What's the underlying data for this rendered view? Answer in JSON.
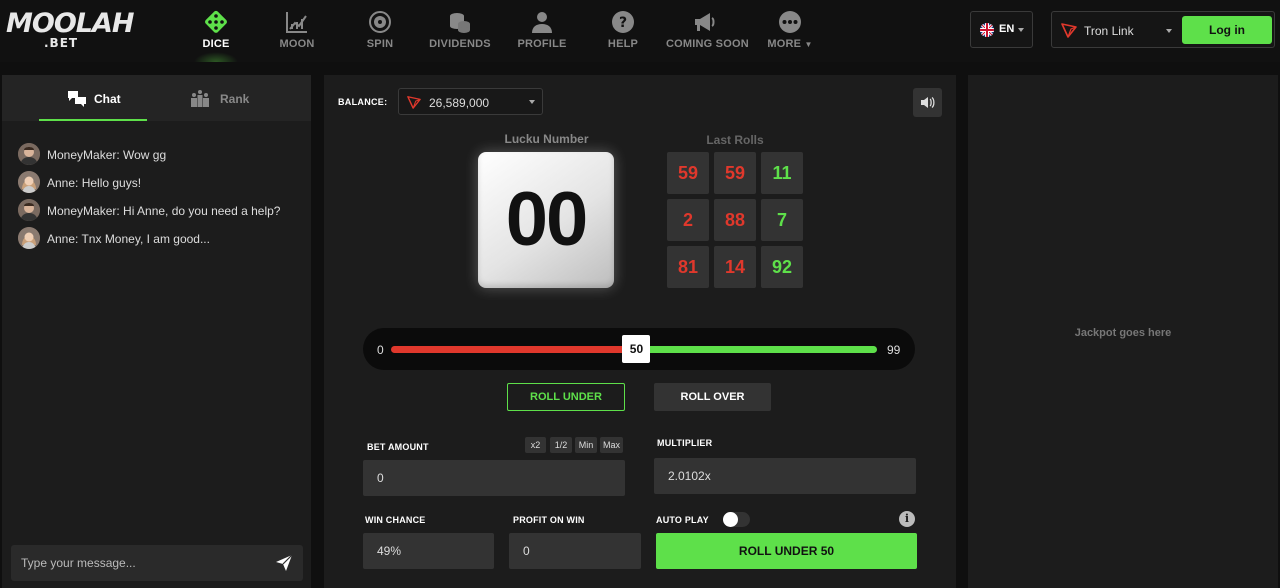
{
  "header": {
    "logo_main": "MOOLAH",
    "logo_sub": ".BET",
    "nav": [
      {
        "label": "DICE",
        "icon": "dice-icon",
        "active": true
      },
      {
        "label": "MOON",
        "icon": "chart-icon",
        "active": false
      },
      {
        "label": "SPIN",
        "icon": "wheel-icon",
        "active": false
      },
      {
        "label": "DIVIDENDS",
        "icon": "coins-icon",
        "active": false
      },
      {
        "label": "PROFILE",
        "icon": "user-icon",
        "active": false
      },
      {
        "label": "HELP",
        "icon": "help-icon",
        "active": false
      },
      {
        "label": "COMING SOON",
        "icon": "megaphone-icon",
        "active": false
      },
      {
        "label": "MORE",
        "icon": "more-icon",
        "active": false
      }
    ],
    "language": "EN",
    "wallet": "Tron Link",
    "login_label": "Log in"
  },
  "chat": {
    "tabs": [
      {
        "label": "Chat",
        "active": true
      },
      {
        "label": "Rank",
        "active": false
      }
    ],
    "messages": [
      {
        "text": "MoneyMaker: Wow gg"
      },
      {
        "text": "Anne: Hello guys!"
      },
      {
        "text": "MoneyMaker: Hi Anne, do you need a help?"
      },
      {
        "text": "Anne: Tnx Money, I am good..."
      }
    ],
    "input_placeholder": "Type your message..."
  },
  "game": {
    "balance_label": "BALANCE:",
    "balance_value": "26,589,000",
    "lucky_label": "Lucku Number",
    "lucky_number": "00",
    "last_rolls_label": "Last Rolls",
    "last_rolls": [
      {
        "value": "59",
        "color": "red"
      },
      {
        "value": "59",
        "color": "red"
      },
      {
        "value": "11",
        "color": "green"
      },
      {
        "value": "2",
        "color": "red"
      },
      {
        "value": "88",
        "color": "red"
      },
      {
        "value": "7",
        "color": "green"
      },
      {
        "value": "81",
        "color": "red"
      },
      {
        "value": "14",
        "color": "red"
      },
      {
        "value": "92",
        "color": "green"
      }
    ],
    "slider": {
      "min": "0",
      "max": "99",
      "value": "50"
    },
    "roll_under_label": "ROLL UNDER",
    "roll_over_label": "ROLL OVER",
    "bet_amount_label": "BET AMOUNT",
    "bet_amount_value": "0",
    "quick_buttons": [
      "x2",
      "1/2",
      "Min",
      "Max"
    ],
    "multiplier_label": "MULTIPLIER",
    "multiplier_value": "2.0102x",
    "win_chance_label": "WIN CHANCE",
    "win_chance_value": "49%",
    "profit_label": "PROFIT ON WIN",
    "profit_value": "0",
    "autoplay_label": "AUTO PLAY",
    "autoplay_on": false,
    "roll_button_label": "ROLL UNDER 50"
  },
  "jackpot": {
    "text": "Jackpot goes here"
  },
  "colors": {
    "accent": "#5ee04a",
    "red": "#e0382c",
    "panel": "#1c1c1c"
  }
}
